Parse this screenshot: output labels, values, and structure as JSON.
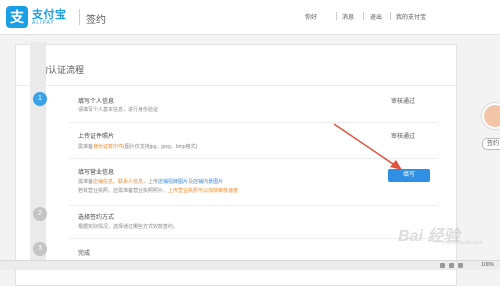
{
  "header": {
    "logo_char": "支",
    "brand_cn": "支付宝",
    "brand_en": "ALIPAY",
    "section": "签约",
    "nav": {
      "greeting": "你好",
      "message": "消息",
      "logout": "退出",
      "my_alipay": "我的支付宝"
    }
  },
  "panel": {
    "title": "签约认证流程"
  },
  "steps": [
    {
      "number": "1"
    },
    {
      "number": "2"
    },
    {
      "number": "3"
    }
  ],
  "rows": {
    "personal": {
      "title": "填写个人信息",
      "desc": "请填写个人基本信息，进行身份验证",
      "status": "审核通过"
    },
    "license": {
      "title": "上传证件照片",
      "desc_prefix": "需准备",
      "desc_link": "身份证复印件",
      "desc_suffix": "(图片仅支持jpg、jpeg、bmp格式)",
      "status": "审核通过"
    },
    "business": {
      "title": "填写营业信息",
      "desc1_prefix": "需准备",
      "desc1_orange": "店铺信息、联系人信息",
      "desc1_mid": "，上传",
      "desc1_blue": "店铺招牌图片",
      "desc1_mid2": "及",
      "desc1_blue2": "店铺内景图片",
      "desc2_prefix": "若有营业执照，还需准备营业执照照片。",
      "desc2_orange": "上传营业执照可以加快审核速度",
      "button": "填写"
    },
    "plan": {
      "title": "选择签约方式",
      "desc": "根据实际情况，选择通过哪些方式收款签约。"
    },
    "done": {
      "title": "完成"
    }
  },
  "side": {
    "button": "签约"
  },
  "statusbar": {
    "zoom": "100%"
  },
  "watermark": {
    "text": "Bai 经验",
    "sub": "jingyan.baidu.com"
  },
  "colors": {
    "brand": "#1a9ee6",
    "accent_button": "#2e8fe5",
    "orange": "#f08a2a",
    "arrow": "#e0533a"
  }
}
